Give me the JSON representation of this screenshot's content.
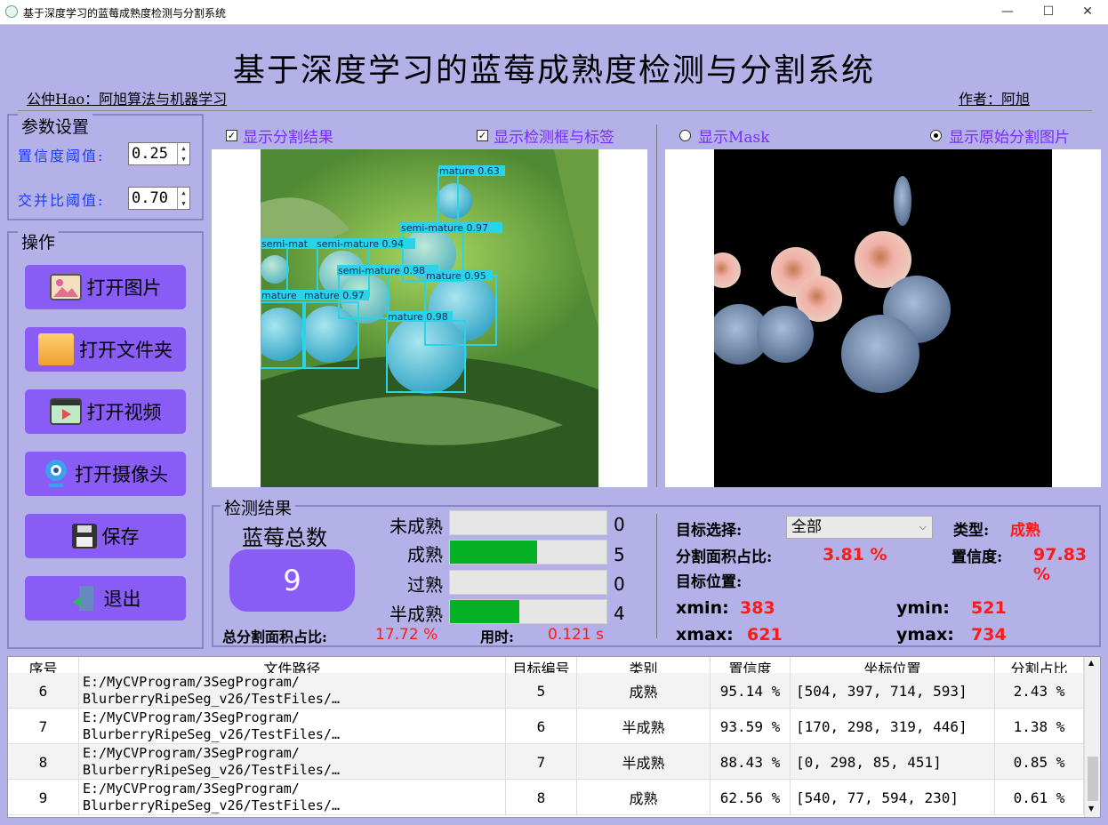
{
  "window": {
    "title": "基于深度学习的蓝莓成熟度检测与分割系统",
    "controls": [
      "—",
      "☐",
      "✕"
    ]
  },
  "header": {
    "main_title": "基于深度学习的蓝莓成熟度检测与分割系统",
    "public_account": "公仲Hao：阿旭算法与机器学习",
    "author": "作者：阿旭"
  },
  "params": {
    "group_title": "参数设置",
    "confidence_label": "置信度阈值:",
    "confidence_value": "0.25",
    "iou_label": "交并比阈值:",
    "iou_value": "0.70"
  },
  "operations": {
    "group_title": "操作",
    "buttons": [
      {
        "label": "打开图片",
        "icon": "image-icon"
      },
      {
        "label": "打开文件夹",
        "icon": "folder-icon"
      },
      {
        "label": "打开视频",
        "icon": "video-icon"
      },
      {
        "label": "打开摄像头",
        "icon": "camera-icon"
      },
      {
        "label": "保存",
        "icon": "save-icon"
      },
      {
        "label": "退出",
        "icon": "exit-icon"
      }
    ]
  },
  "display_options": {
    "show_seg": "显示分割结果",
    "show_boxes": "显示检测框与标签",
    "show_mask": "显示Mask",
    "show_orig_seg": "显示原始分割图片"
  },
  "detections": [
    {
      "label": "mature 0.63"
    },
    {
      "label": "semi-mature 0.97"
    },
    {
      "label": "semi-mature 0.94"
    },
    {
      "label": "semi-mat"
    },
    {
      "label": "semi-mature 0.98"
    },
    {
      "label": "mature 0.95"
    },
    {
      "label": "mature"
    },
    {
      "label": "mature 0.97"
    },
    {
      "label": "mature 0.98"
    }
  ],
  "results": {
    "group_title": "检测结果",
    "total_label": "蓝莓总数",
    "total_value": "9",
    "bars": [
      {
        "label": "未成熟",
        "count": "0",
        "fraction": 0
      },
      {
        "label": "成熟",
        "count": "5",
        "fraction": 0.555
      },
      {
        "label": "过熟",
        "count": "0",
        "fraction": 0
      },
      {
        "label": "半成熟",
        "count": "4",
        "fraction": 0.444
      }
    ],
    "total_area_label": "总分割面积占比:",
    "total_area_value": "17.72 %",
    "time_label": "用时:",
    "time_value": "0.121 s",
    "target_label": "目标选择:",
    "target_value": "全部",
    "type_label": "类型:",
    "type_value": "成熟",
    "area_label": "分割面积占比:",
    "area_value": "3.81 %",
    "conf_label": "置信度:",
    "conf_value": "97.83 %",
    "position_label": "目标位置:",
    "xmin_label": "xmin:",
    "xmin_value": "383",
    "ymin_label": "ymin:",
    "ymin_value": "521",
    "xmax_label": "xmax:",
    "xmax_value": "621",
    "ymax_label": "ymax:",
    "ymax_value": "734"
  },
  "table": {
    "headers": [
      "序号",
      "文件路径",
      "目标编号",
      "类别",
      "置信度",
      "坐标位置",
      "分割占比"
    ],
    "rows": [
      {
        "idx": "6",
        "path": "E:/MyCVProgram/3SegProgram/\nBlurberryRipeSeg_v26/TestFiles/…",
        "target": "5",
        "cls": "成熟",
        "conf": "95.14 %",
        "coord": "[504, 397, 714, 593]",
        "ratio": "2.43 %"
      },
      {
        "idx": "7",
        "path": "E:/MyCVProgram/3SegProgram/\nBlurberryRipeSeg_v26/TestFiles/…",
        "target": "6",
        "cls": "半成熟",
        "conf": "93.59 %",
        "coord": "[170, 298, 319, 446]",
        "ratio": "1.38 %"
      },
      {
        "idx": "8",
        "path": "E:/MyCVProgram/3SegProgram/\nBlurberryRipeSeg_v26/TestFiles/…",
        "target": "7",
        "cls": "半成熟",
        "conf": "88.43 %",
        "coord": "[0, 298, 85, 451]",
        "ratio": "0.85 %"
      },
      {
        "idx": "9",
        "path": "E:/MyCVProgram/3SegProgram/\nBlurberryRipeSeg_v26/TestFiles/…",
        "target": "8",
        "cls": "成熟",
        "conf": "62.56 %",
        "coord": "[540, 77, 594, 230]",
        "ratio": "0.61 %"
      }
    ]
  },
  "colors": {
    "background": "#b4b0e8",
    "button": "#8a5cf6",
    "bar_fill": "#06b025",
    "value_red": "#ff1a1a",
    "checkbox_text": "#7b2cff",
    "param_label": "#1a3cff"
  }
}
